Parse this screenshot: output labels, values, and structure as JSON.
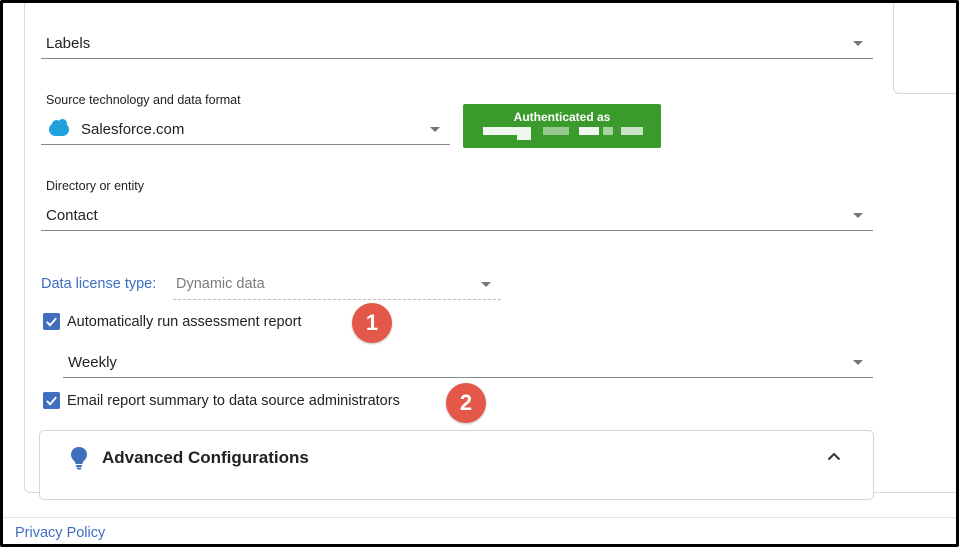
{
  "labels_field": {
    "value": "Labels"
  },
  "source": {
    "label": "Source technology and data format",
    "value": "Salesforce.com",
    "logo_icon": "salesforce-cloud-icon"
  },
  "auth_button": {
    "label": "Authenticated as",
    "color": "#3a9a2c"
  },
  "directory": {
    "label": "Directory or entity",
    "value": "Contact"
  },
  "license": {
    "label": "Data license type:",
    "value": "Dynamic data"
  },
  "auto_run": {
    "label": "Automatically run assessment report",
    "checked": true
  },
  "frequency": {
    "value": "Weekly"
  },
  "email_summary": {
    "label": "Email report summary to data source administrators",
    "checked": true
  },
  "badges": [
    "1",
    "2"
  ],
  "advanced": {
    "heading": "Advanced Configurations",
    "icon": "lightbulb-icon"
  },
  "footer": {
    "privacy_link": "Privacy Policy"
  },
  "colors": {
    "accent": "#3d6cc4",
    "checkbox": "#3f6fbd",
    "badge": "#e4584a"
  }
}
